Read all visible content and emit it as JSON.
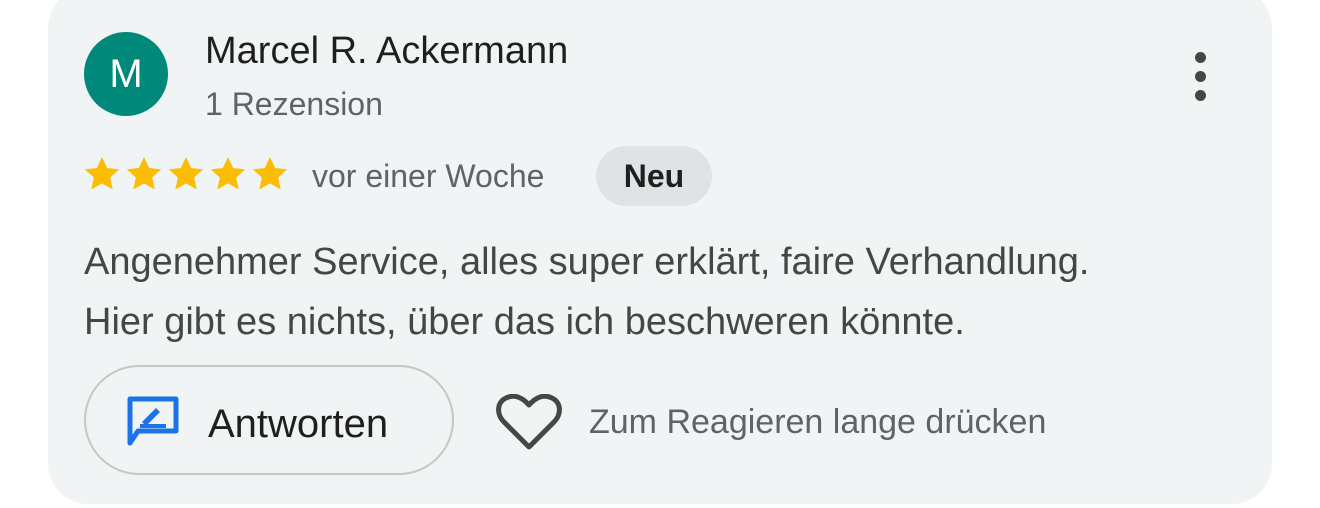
{
  "review": {
    "author": {
      "initial": "M",
      "name": "Marcel R. Ackermann",
      "review_count_text": "1 Rezension",
      "avatar_color": "#00897b"
    },
    "rating": {
      "stars": 5,
      "max": 5,
      "star_color": "#fbbc04"
    },
    "time_text": "vor einer Woche",
    "badge_text": "Neu",
    "text_lines": [
      "Angenehmer Service, alles super erklärt, faire Verhandlung.",
      "Hier gibt es nichts, über das ich beschweren könnte."
    ]
  },
  "actions": {
    "reply_label": "Antworten",
    "reply_icon": "reply-edit-icon",
    "react_icon": "heart-outline-icon",
    "react_hint": "Zum Reagieren lange drücken",
    "more_icon": "more-vert-icon",
    "accent_color": "#1a73e8"
  }
}
